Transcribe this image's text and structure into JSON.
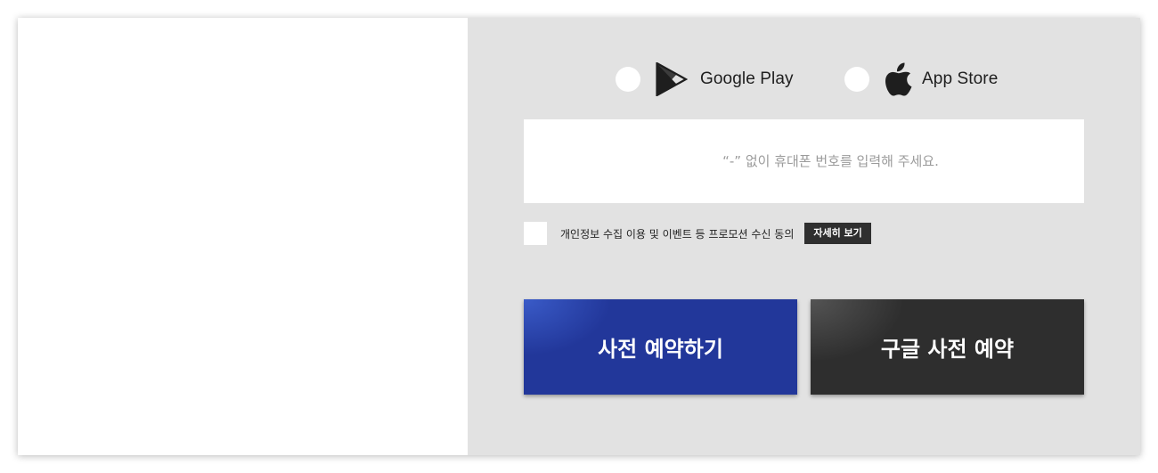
{
  "platforms": {
    "google_play": {
      "label": "Google Play",
      "icon": "google-play-icon",
      "selected": false
    },
    "app_store": {
      "label": "App Store",
      "icon": "apple-icon",
      "selected": false
    }
  },
  "phone": {
    "placeholder": "“-” 없이 휴대폰 번호를 입력해 주세요.",
    "value": ""
  },
  "consent": {
    "label": "개인정보 수집 이용 및 이벤트 등 프로모션 수신 동의",
    "details_button": "자세히 보기",
    "checked": false
  },
  "actions": {
    "preorder_button": "사전 예약하기",
    "google_preorder_button": "구글 사전 예약"
  },
  "colors": {
    "panel_background": "#e2e2e2",
    "preorder_blue": "#22379a",
    "google_dark": "#2e2e2e",
    "details_button": "#2f2f2f"
  }
}
